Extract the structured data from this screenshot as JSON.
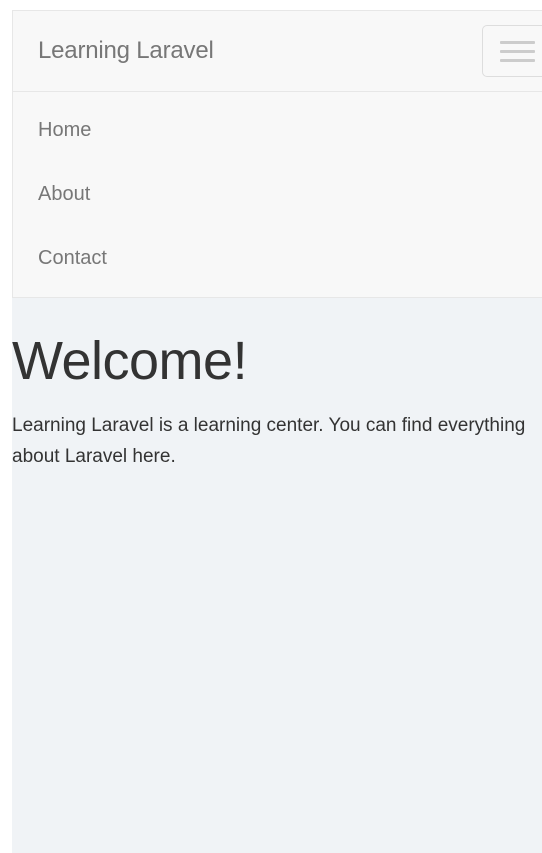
{
  "navbar": {
    "brand": "Learning Laravel",
    "items": [
      {
        "label": "Home"
      },
      {
        "label": "About"
      },
      {
        "label": "Contact"
      }
    ],
    "toggle_icon": "hamburger-icon"
  },
  "main": {
    "heading": "Welcome!",
    "intro": "Learning Laravel is a learning center. You can find everything about Laravel here."
  },
  "colors": {
    "navbar_bg": "#f8f8f8",
    "page_bg": "#f0f3f6",
    "nav_text": "#777777",
    "body_text": "#333333"
  }
}
